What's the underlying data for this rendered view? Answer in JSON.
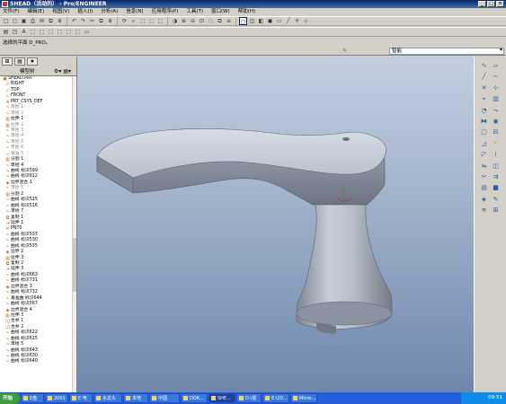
{
  "window": {
    "title": "SHEAD（活动的） - Pro/ENGINEER"
  },
  "menu": [
    "文件(F)",
    "编辑(E)",
    "视图(V)",
    "插入(I)",
    "分析(A)",
    "信息(N)",
    "应用程序(P)",
    "工具(T)",
    "窗口(W)",
    "帮助(H)"
  ],
  "toolbar1": [
    "new-icon",
    "open-icon",
    "save-icon",
    "print-icon",
    "mail-icon",
    "copy-icon",
    "paste-icon",
    "undo-icon",
    "redo-icon",
    "cut-icon",
    "copy2-icon",
    "paste2-icon",
    "regen-icon",
    "find-icon",
    "select-icon",
    "repaint-icon",
    "orient-icon",
    "shade-icon",
    "zoom-in-icon",
    "zoom-out-icon",
    "refit-icon",
    "spin-icon",
    "saved-view-icon",
    "layers-icon",
    "wireframe-icon",
    "hidden-icon",
    "no-hidden-icon",
    "shading-icon",
    "datum-plane-icon",
    "datum-axis-icon",
    "datum-point-icon",
    "csys-icon"
  ],
  "toolbar1_glyphs": [
    "□",
    "▢",
    "▣",
    "⎙",
    "✉",
    "⧉",
    "⧈",
    "↶",
    "↷",
    "✂",
    "⧉",
    "⧈",
    "⟳",
    "⌕",
    "⬚",
    "⬚",
    "⬚",
    "◑",
    "⊕",
    "⊖",
    "⊡",
    "◌",
    "⧉",
    "≡",
    "◻",
    "◫",
    "◧",
    "◼",
    "▭",
    "╱",
    "✳",
    "⊹"
  ],
  "toolbar2_glyphs": [
    "▤",
    "◳",
    "A",
    "⬚",
    "⬚",
    "⬚",
    "⬚",
    "⬚",
    "⬚",
    "▭"
  ],
  "message": "选择的平面 D_PRO。",
  "filter": {
    "value": "智能"
  },
  "panel": {
    "title": "模型树"
  },
  "tree": [
    {
      "label": "SHEAD.PRT",
      "icon": "▣",
      "dim": false
    },
    {
      "label": "RIGHT",
      "icon": "▱",
      "dim": false
    },
    {
      "label": "TOP",
      "icon": "▱",
      "dim": false
    },
    {
      "label": "FRONT",
      "icon": "▱",
      "dim": false
    },
    {
      "label": "PRT_CSYS_DEF",
      "icon": "✳",
      "dim": false
    },
    {
      "label": "草绘 1",
      "icon": "~",
      "dim": true
    },
    {
      "label": "草绘 2",
      "icon": "~",
      "dim": true
    },
    {
      "label": "拉伸 1",
      "icon": "▥",
      "dim": false
    },
    {
      "label": "拉伸 2",
      "icon": "▥",
      "dim": true
    },
    {
      "label": "草绘 3",
      "icon": "~",
      "dim": true
    },
    {
      "label": "草绘 4",
      "icon": "~",
      "dim": true
    },
    {
      "label": "草绘 5",
      "icon": "~",
      "dim": true
    },
    {
      "label": "草绘 6",
      "icon": "~",
      "dim": true
    },
    {
      "label": "基准 5",
      "icon": "▱",
      "dim": true
    },
    {
      "label": "分割 1",
      "icon": "▥",
      "dim": false
    },
    {
      "label": "草绘 4",
      "icon": "~",
      "dim": false
    },
    {
      "label": "曲线 标识599",
      "icon": "~",
      "dim": false
    },
    {
      "label": "曲线 标识612",
      "icon": "~",
      "dim": false
    },
    {
      "label": "边界混合 1",
      "icon": "◈",
      "dim": false
    },
    {
      "label": "草绘 5",
      "icon": "~",
      "dim": true
    },
    {
      "label": "分割 2",
      "icon": "▥",
      "dim": false
    },
    {
      "label": "曲线 标识515",
      "icon": "~",
      "dim": false
    },
    {
      "label": "曲线 标识516",
      "icon": "~",
      "dim": false
    },
    {
      "label": "草绘 7",
      "icon": "~",
      "dim": false
    },
    {
      "label": "复制 1",
      "icon": "⧉",
      "dim": false
    },
    {
      "label": "延伸 1",
      "icon": "⇥",
      "dim": false
    },
    {
      "label": "PNT0",
      "icon": "✕",
      "dim": false
    },
    {
      "label": "曲线 标识537",
      "icon": "~",
      "dim": false
    },
    {
      "label": "曲线 标识530",
      "icon": "~",
      "dim": false
    },
    {
      "label": "曲线 标识535",
      "icon": "~",
      "dim": false
    },
    {
      "label": "边界 2",
      "icon": "◈",
      "dim": false
    },
    {
      "label": "拉伸 3",
      "icon": "▥",
      "dim": false
    },
    {
      "label": "复制 2",
      "icon": "⧉",
      "dim": false
    },
    {
      "label": "延伸 3",
      "icon": "⇥",
      "dim": false
    },
    {
      "label": "曲线 标识663",
      "icon": "~",
      "dim": false
    },
    {
      "label": "曲线 标识731",
      "icon": "~",
      "dim": false
    },
    {
      "label": "边界混合 3",
      "icon": "◈",
      "dim": false
    },
    {
      "label": "曲线 标识732",
      "icon": "~",
      "dim": false
    },
    {
      "label": "基准曲 标识644",
      "icon": "~",
      "dim": false
    },
    {
      "label": "曲线 标识567",
      "icon": "~",
      "dim": false
    },
    {
      "label": "边界混合 4",
      "icon": "◈",
      "dim": false
    },
    {
      "label": "拉伸 3",
      "icon": "▥",
      "dim": false
    },
    {
      "label": "合并 1",
      "icon": "◫",
      "dim": false
    },
    {
      "label": "合并 2",
      "icon": "◫",
      "dim": false
    },
    {
      "label": "曲线 标识622",
      "icon": "~",
      "dim": false
    },
    {
      "label": "曲线 标识625",
      "icon": "~",
      "dim": false
    },
    {
      "label": "草绘 5",
      "icon": "~",
      "dim": false
    },
    {
      "label": "曲线 标识643",
      "icon": "~",
      "dim": false
    },
    {
      "label": "曲线 标识630",
      "icon": "~",
      "dim": false
    },
    {
      "label": "曲线 标识640",
      "icon": "~",
      "dim": false
    }
  ],
  "right_toolbar": [
    "sketch-icon",
    "plane-icon",
    "axis-icon",
    "curve-icon",
    "point-icon",
    "csys-icon",
    "analysis-icon",
    "extrude-icon",
    "revolve-icon",
    "sweep-icon",
    "blend-icon",
    "hole-icon",
    "shell-icon",
    "rib-icon",
    "draft-icon",
    "round-icon",
    "chamfer-icon",
    "pattern-icon",
    "mirror-icon",
    "merge-icon",
    "trim-icon",
    "offset-icon",
    "thicken-icon",
    "solidify-icon",
    "boundary-icon",
    "style-icon",
    "warp-icon",
    "datum-icon"
  ],
  "taskbar": {
    "start": "开始",
    "tasks": [
      "E盘",
      "2063",
      "E 电",
      "水龙头",
      "本地",
      "中国",
      "DOK...",
      "SHE...",
      "D:\\视",
      "E:\\20...",
      "Micro..."
    ],
    "clock": "09:51"
  }
}
